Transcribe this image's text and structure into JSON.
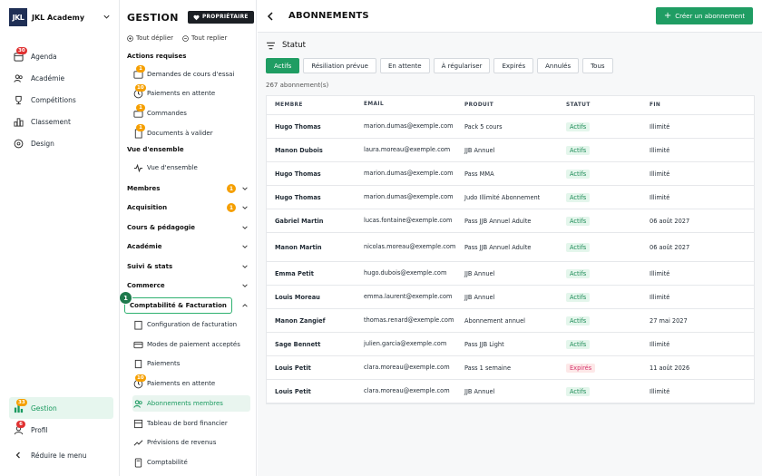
{
  "app": {
    "logo_text": "JKL",
    "name": "JKL Academy"
  },
  "primary_nav": [
    {
      "label": "Agenda",
      "icon": "calendar-icon",
      "badge": "30"
    },
    {
      "label": "Académie",
      "icon": "users-icon"
    },
    {
      "label": "Compétitions",
      "icon": "trophy-icon"
    },
    {
      "label": "Classement",
      "icon": "ranking-icon"
    },
    {
      "label": "Design",
      "icon": "palette-icon"
    }
  ],
  "bottom_nav": [
    {
      "label": "Gestion",
      "icon": "gestion-icon",
      "badge": "33"
    },
    {
      "label": "Profil",
      "icon": "profile-icon",
      "badge": "6"
    },
    {
      "label": "Réduire le menu",
      "icon": "collapse-icon"
    }
  ],
  "gestion": {
    "title": "GESTION",
    "owner_badge": "PROPRIÉTAIRE",
    "expand_all": "Tout déplier",
    "collapse_all": "Tout replier",
    "actions_title": "Actions requises",
    "actions": [
      {
        "label": "Demandes de cours d'essai",
        "badge": "1"
      },
      {
        "label": "Paiements en attente",
        "badge": "10"
      },
      {
        "label": "Commandes",
        "badge": "1"
      },
      {
        "label": "Documents à valider",
        "badge": "1"
      }
    ],
    "overview_title": "Vue d'ensemble",
    "overview_item": "Vue d'ensemble",
    "groups": [
      {
        "label": "Membres",
        "badge": "1"
      },
      {
        "label": "Acquisition",
        "badge": "1"
      },
      {
        "label": "Cours & pédagogie"
      },
      {
        "label": "Académie"
      },
      {
        "label": "Suivi & stats"
      },
      {
        "label": "Commerce"
      },
      {
        "label": "Comptabilité & Facturation"
      }
    ],
    "step_marker": "1",
    "billing_items": [
      {
        "label": "Configuration de facturation"
      },
      {
        "label": "Modes de paiement acceptés"
      },
      {
        "label": "Paiements"
      },
      {
        "label": "Paiements en attente",
        "badge": "10"
      },
      {
        "label": "Abonnements membres"
      },
      {
        "label": "Tableau de bord financier"
      },
      {
        "label": "Prévisions de revenus"
      },
      {
        "label": "Comptabilité"
      }
    ]
  },
  "page": {
    "title": "ABONNEMENTS",
    "create_button": "Créer un abonnement",
    "filter_title": "Statut",
    "filters": [
      "Actifs",
      "Résiliation prévue",
      "En attente",
      "À régulariser",
      "Expirés",
      "Annulés",
      "Tous"
    ],
    "active_filter": "Actifs",
    "count": "267 abonnement(s)",
    "columns": [
      "MEMBRE",
      "EMAIL",
      "PRODUIT",
      "STATUT",
      "FIN"
    ],
    "rows": [
      {
        "member": "Hugo Thomas",
        "email": "marion.dumas@exemple.com",
        "product": "Pack 5 cours",
        "status": "Actifs",
        "end": "Illimité"
      },
      {
        "member": "Manon Dubois",
        "email": "laura.moreau@exemple.com",
        "product": "JJB Annuel",
        "status": "Actifs",
        "end": "Illimité"
      },
      {
        "member": "Hugo Thomas",
        "email": "marion.dumas@exemple.com",
        "product": "Pass MMA",
        "status": "Actifs",
        "end": "Illimité"
      },
      {
        "member": "Hugo Thomas",
        "email": "marion.dumas@exemple.com",
        "product": "Judo Illimité Abonnement",
        "status": "Actifs",
        "end": "Illimité"
      },
      {
        "member": "Gabriel Martin",
        "email": "lucas.fontaine@exemple.com",
        "product": "Pass JJB Annuel Adulte",
        "status": "Actifs",
        "end": "06 août 2027"
      },
      {
        "member": "Manon Martin",
        "email": "nicolas.moreau@exemple.com",
        "product": "Pass JJB Annuel Adulte",
        "status": "Actifs",
        "end": "06 août 2027"
      },
      {
        "member": "Emma Petit",
        "email": "hugo.dubois@exemple.com",
        "product": "JJB Annuel",
        "status": "Actifs",
        "end": "Illimité"
      },
      {
        "member": "Louis Moreau",
        "email": "emma.laurent@exemple.com",
        "product": "JJB Annuel",
        "status": "Actifs",
        "end": "Illimité"
      },
      {
        "member": "Manon Zangief",
        "email": "thomas.renard@exemple.com",
        "product": "Abonnement annuel",
        "status": "Actifs",
        "end": "27 mai 2027"
      },
      {
        "member": "Sage Bennett",
        "email": "julien.garcia@exemple.com",
        "product": "Pass JJB Light",
        "status": "Actifs",
        "end": "Illimité"
      },
      {
        "member": "Louis Petit",
        "email": "clara.moreau@exemple.com",
        "product": "Pass 1 semaine",
        "status": "Expirés",
        "end": "11 août 2026"
      },
      {
        "member": "Louis Petit",
        "email": "clara.moreau@exemple.com",
        "product": "JJB Annuel",
        "status": "Actifs",
        "end": "Illimité"
      }
    ]
  },
  "colors": {
    "accent": "#1f9d63",
    "dark": "#1b1f24",
    "warn": "#f59f00",
    "danger": "#e03131"
  }
}
